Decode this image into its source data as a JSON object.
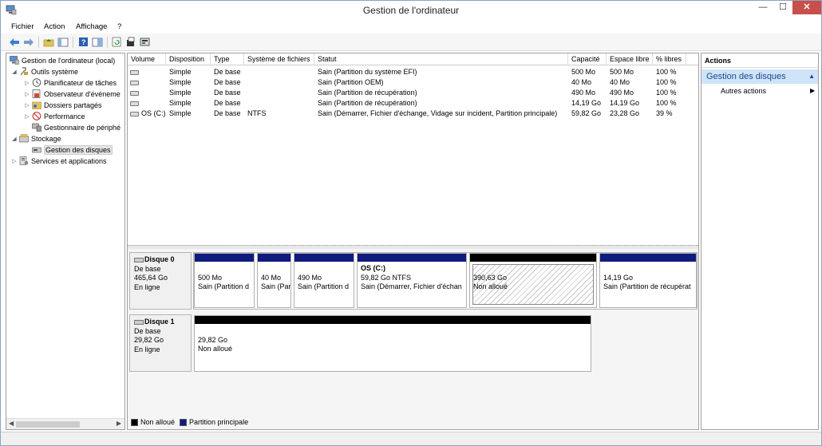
{
  "window": {
    "title": "Gestion de l'ordinateur",
    "min": "—",
    "max": "☐",
    "close": "✕"
  },
  "menu": [
    "Fichier",
    "Action",
    "Affichage",
    "?"
  ],
  "tree": {
    "root": "Gestion de l'ordinateur (local)",
    "tools": "Outils système",
    "scheduler": "Planificateur de tâches",
    "eventviewer": "Observateur d'événeme",
    "shared": "Dossiers partagés",
    "perf": "Performance",
    "devmgr": "Gestionnaire de périphé",
    "storage": "Stockage",
    "diskmgmt": "Gestion des disques",
    "services": "Services et applications"
  },
  "table": {
    "headers": [
      "Volume",
      "Disposition",
      "Type",
      "Système de fichiers",
      "Statut",
      "Capacité",
      "Espace libre",
      "% libres"
    ],
    "rows": [
      [
        "",
        "Simple",
        "De base",
        "",
        "Sain (Partition du système EFI)",
        "500 Mo",
        "500 Mo",
        "100 %"
      ],
      [
        "",
        "Simple",
        "De base",
        "",
        "Sain (Partition OEM)",
        "40 Mo",
        "40 Mo",
        "100 %"
      ],
      [
        "",
        "Simple",
        "De base",
        "",
        "Sain (Partition de récupération)",
        "490 Mo",
        "490 Mo",
        "100 %"
      ],
      [
        "",
        "Simple",
        "De base",
        "",
        "Sain (Partition de récupération)",
        "14,19 Go",
        "14,19 Go",
        "100 %"
      ],
      [
        "OS (C:)",
        "Simple",
        "De base",
        "NTFS",
        "Sain (Démarrer, Fichier d'échange, Vidage sur incident, Partition principale)",
        "59,82 Go",
        "23,28 Go",
        "39 %"
      ]
    ]
  },
  "disks": {
    "d0": {
      "name": "Disque 0",
      "type": "De base",
      "size": "465,64 Go",
      "status": "En ligne"
    },
    "d0p": [
      {
        "l1": "",
        "l2": "500 Mo",
        "l3": "Sain (Partition d"
      },
      {
        "l1": "",
        "l2": "40 Mo",
        "l3": "Sain (Par"
      },
      {
        "l1": "",
        "l2": "490 Mo",
        "l3": "Sain (Partition d"
      },
      {
        "l1": "OS  (C:)",
        "l2": "59,82 Go NTFS",
        "l3": "Sain (Démarrer, Fichier d'échan"
      },
      {
        "l1": "",
        "l2": "390,63 Go",
        "l3": "Non alloué"
      },
      {
        "l1": "",
        "l2": "14,19 Go",
        "l3": "Sain (Partition de récupérat"
      }
    ],
    "d1": {
      "name": "Disque 1",
      "type": "De base",
      "size": "29,82 Go",
      "status": "En ligne"
    },
    "d1p": {
      "l2": "29,82 Go",
      "l3": "Non alloué"
    }
  },
  "legend": {
    "unalloc": "Non alloué",
    "primary": "Partition principale"
  },
  "actions": {
    "head": "Actions",
    "selected": "Gestion des disques",
    "more": "Autres actions"
  },
  "colors": {
    "primary": "#101b7e",
    "unallocated": "#000000",
    "selection": "#cfe3f9"
  }
}
